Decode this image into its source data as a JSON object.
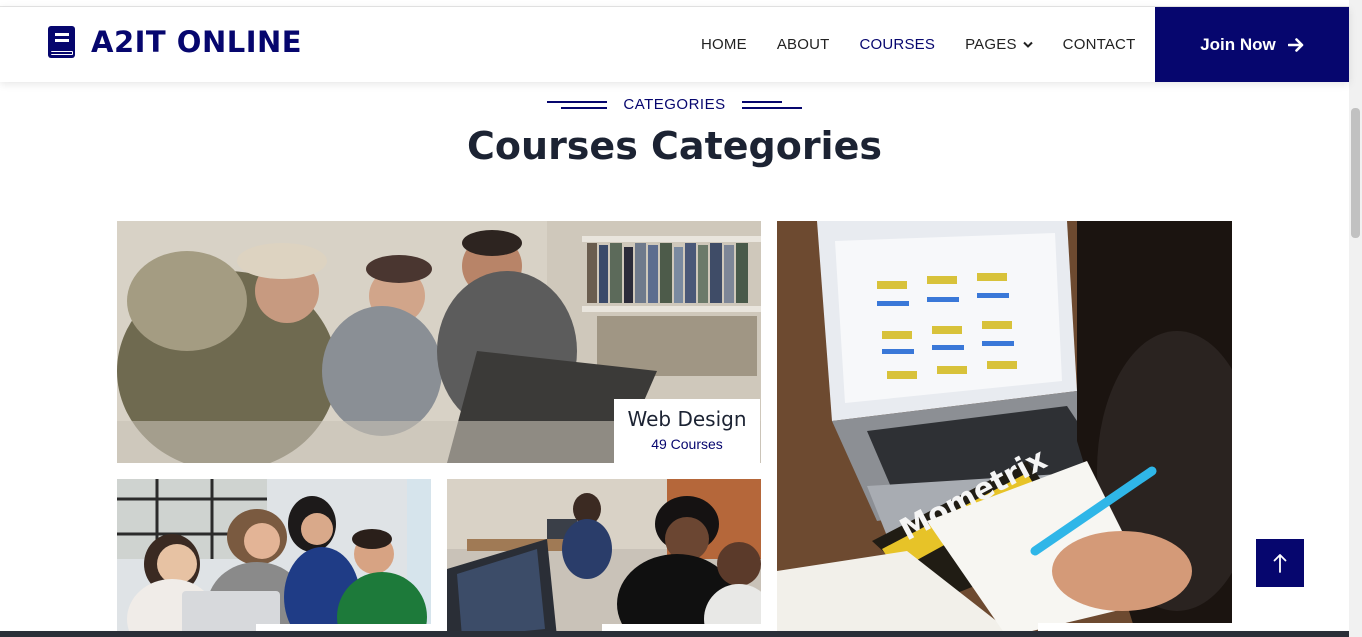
{
  "brand": {
    "name": "A2IT ONLINE",
    "icon": "book-icon"
  },
  "nav": {
    "items": [
      {
        "label": "HOME",
        "active": false
      },
      {
        "label": "ABOUT",
        "active": false
      },
      {
        "label": "COURSES",
        "active": true
      },
      {
        "label": "PAGES",
        "active": false,
        "has_dropdown": true
      },
      {
        "label": "CONTACT",
        "active": false
      }
    ],
    "join_label": "Join Now",
    "join_icon": "arrow-right-icon"
  },
  "section": {
    "tag": "CATEGORIES",
    "title": "Courses Categories"
  },
  "categories": [
    {
      "title": "Web Design",
      "count": "49 Courses",
      "image": "students-laughing-at-laptop"
    },
    {
      "title": "",
      "count": "",
      "image": "group-around-laptop"
    },
    {
      "title": "",
      "count": "",
      "image": "students-at-computers"
    },
    {
      "title": "",
      "count": "",
      "image": "laptop-and-test-prep-book"
    }
  ],
  "back_to_top_icon": "arrow-up-icon",
  "colors": {
    "brand": "#06066e",
    "heading": "#1c2333",
    "text": "#222222"
  }
}
